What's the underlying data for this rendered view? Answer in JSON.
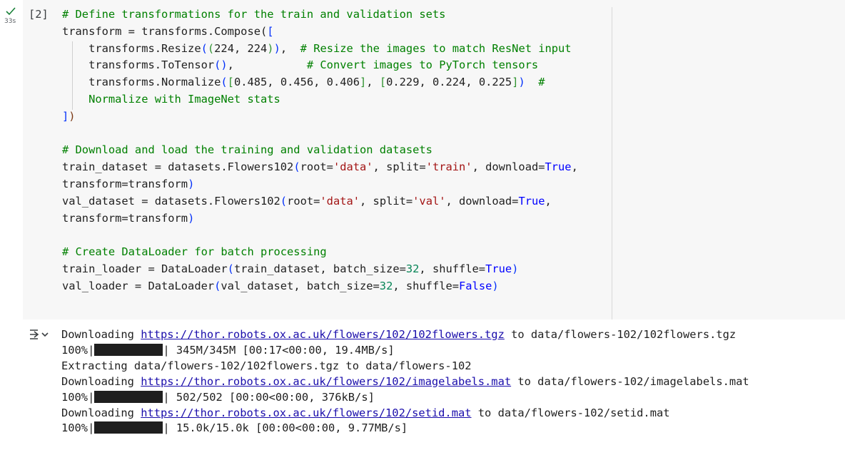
{
  "cell": {
    "status_icon": "check-icon",
    "run_time": "33s",
    "execution_count": "[2]"
  },
  "code": {
    "lines": [
      {
        "parts": [
          {
            "t": "# Define transformations for the train and validation sets",
            "c": "comment"
          }
        ]
      },
      {
        "parts": [
          {
            "t": "transform = transforms.Compose(",
            "c": ""
          },
          {
            "t": "[",
            "c": "br"
          }
        ]
      },
      {
        "parts": [
          {
            "t": "    transforms.Resize",
            "c": ""
          },
          {
            "t": "(",
            "c": "br"
          },
          {
            "t": "(",
            "c": "br2"
          },
          {
            "t": "224, 224",
            "c": ""
          },
          {
            "t": ")",
            "c": "br2"
          },
          {
            "t": ")",
            "c": "br"
          },
          {
            "t": ",  ",
            "c": ""
          },
          {
            "t": "# Resize the images to match ResNet input",
            "c": "comment"
          }
        ]
      },
      {
        "parts": [
          {
            "t": "    transforms.ToTensor",
            "c": ""
          },
          {
            "t": "()",
            "c": "br"
          },
          {
            "t": ",           ",
            "c": ""
          },
          {
            "t": "# Convert images to PyTorch tensors",
            "c": "comment"
          }
        ]
      },
      {
        "parts": [
          {
            "t": "    transforms.Normalize",
            "c": ""
          },
          {
            "t": "(",
            "c": "br"
          },
          {
            "t": "[",
            "c": "br2"
          },
          {
            "t": "0.485, 0.456, 0.406",
            "c": ""
          },
          {
            "t": "]",
            "c": "br2"
          },
          {
            "t": ", ",
            "c": ""
          },
          {
            "t": "[",
            "c": "br2"
          },
          {
            "t": "0.229, 0.224, 0.225",
            "c": ""
          },
          {
            "t": "]",
            "c": "br2"
          },
          {
            "t": ")",
            "c": "br"
          },
          {
            "t": "  #",
            "c": "comment"
          }
        ]
      },
      {
        "parts": [
          {
            "t": "    Normalize with ImageNet stats",
            "c": "comment"
          }
        ]
      },
      {
        "parts": [
          {
            "t": "]",
            "c": "br"
          },
          {
            "t": ")",
            "c": "p"
          }
        ]
      },
      {
        "parts": [
          {
            "t": "",
            "c": ""
          }
        ]
      },
      {
        "parts": [
          {
            "t": "# Download and load the training and validation datasets",
            "c": "comment"
          }
        ]
      },
      {
        "parts": [
          {
            "t": "train_dataset = datasets.Flowers102",
            "c": ""
          },
          {
            "t": "(",
            "c": "br"
          },
          {
            "t": "root=",
            "c": ""
          },
          {
            "t": "'data'",
            "c": "str"
          },
          {
            "t": ", split=",
            "c": ""
          },
          {
            "t": "'train'",
            "c": "str"
          },
          {
            "t": ", download=",
            "c": ""
          },
          {
            "t": "True",
            "c": "kw"
          },
          {
            "t": ",",
            "c": ""
          }
        ]
      },
      {
        "parts": [
          {
            "t": "transform=transform",
            "c": ""
          },
          {
            "t": ")",
            "c": "br"
          }
        ]
      },
      {
        "parts": [
          {
            "t": "val_dataset = datasets.Flowers102",
            "c": ""
          },
          {
            "t": "(",
            "c": "br"
          },
          {
            "t": "root=",
            "c": ""
          },
          {
            "t": "'data'",
            "c": "str"
          },
          {
            "t": ", split=",
            "c": ""
          },
          {
            "t": "'val'",
            "c": "str"
          },
          {
            "t": ", download=",
            "c": ""
          },
          {
            "t": "True",
            "c": "kw"
          },
          {
            "t": ",",
            "c": ""
          }
        ]
      },
      {
        "parts": [
          {
            "t": "transform=transform",
            "c": ""
          },
          {
            "t": ")",
            "c": "br"
          }
        ]
      },
      {
        "parts": [
          {
            "t": "",
            "c": ""
          }
        ]
      },
      {
        "parts": [
          {
            "t": "# Create DataLoader for batch processing",
            "c": "comment"
          }
        ]
      },
      {
        "parts": [
          {
            "t": "train_loader = DataLoader",
            "c": ""
          },
          {
            "t": "(",
            "c": "br"
          },
          {
            "t": "train_dataset, batch_size=",
            "c": ""
          },
          {
            "t": "32",
            "c": "num"
          },
          {
            "t": ", shuffle=",
            "c": ""
          },
          {
            "t": "True",
            "c": "kw"
          },
          {
            "t": ")",
            "c": "br"
          }
        ]
      },
      {
        "parts": [
          {
            "t": "val_loader = DataLoader",
            "c": ""
          },
          {
            "t": "(",
            "c": "br"
          },
          {
            "t": "val_dataset, batch_size=",
            "c": ""
          },
          {
            "t": "32",
            "c": "num"
          },
          {
            "t": ", shuffle=",
            "c": ""
          },
          {
            "t": "False",
            "c": "kw"
          },
          {
            "t": ")",
            "c": "br"
          }
        ]
      }
    ]
  },
  "output": {
    "toggle_icon": "output-toggle-icon",
    "lines": [
      {
        "pre": "Downloading ",
        "link": "https://thor.robots.ox.ac.uk/flowers/102/102flowers.tgz",
        "post": " to data/flowers-102/102flowers.tgz"
      },
      {
        "pct": "100%|",
        "bar": true,
        "post": "| 345M/345M [00:17<00:00, 19.4MB/s]"
      },
      {
        "pre": "Extracting data/flowers-102/102flowers.tgz to data/flowers-102"
      },
      {
        "pre": "Downloading ",
        "link": "https://thor.robots.ox.ac.uk/flowers/102/imagelabels.mat",
        "post": " to data/flowers-102/imagelabels.mat"
      },
      {
        "pct": "100%|",
        "bar": true,
        "post": "| 502/502 [00:00<00:00, 376kB/s]"
      },
      {
        "pre": "Downloading ",
        "link": "https://thor.robots.ox.ac.uk/flowers/102/setid.mat",
        "post": " to data/flowers-102/setid.mat"
      },
      {
        "pct": "100%|",
        "bar": true,
        "post": "| 15.0k/15.0k [00:00<00:00, 9.77MB/s]"
      }
    ],
    "progress": [
      1.0,
      1.0,
      1.0
    ]
  }
}
